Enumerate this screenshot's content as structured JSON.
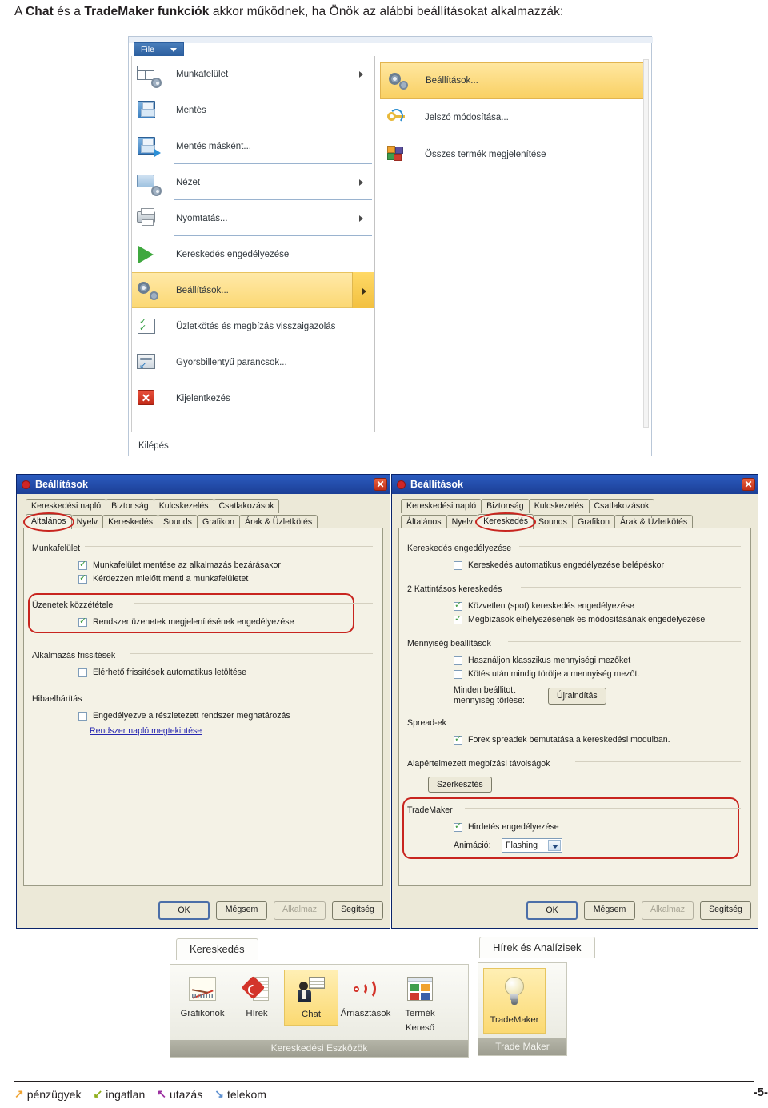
{
  "intro": {
    "before": "A ",
    "bold1": "Chat",
    "mid1": " és a ",
    "bold2": "TradeMaker funkciók",
    "after": " akkor működnek, ha Önök az alábbi beállításokat alkalmazzák:"
  },
  "file_menu": {
    "tab_label": "File",
    "items": [
      {
        "label": "Munkafelület",
        "icon": "workspace-icon",
        "submenu": true
      },
      {
        "label": "Mentés",
        "icon": "save-icon",
        "submenu": false
      },
      {
        "label": "Mentés másként...",
        "icon": "save-as-icon",
        "submenu": false
      },
      {
        "label": "Nézet",
        "icon": "view-icon",
        "submenu": true
      },
      {
        "label": "Nyomtatás...",
        "icon": "printer-icon",
        "submenu": true
      },
      {
        "label": "Kereskedés engedélyezése",
        "icon": "play-icon",
        "submenu": false
      },
      {
        "label": "Beállítások...",
        "icon": "gears-icon",
        "submenu": true,
        "highlighted": true
      },
      {
        "label": "Üzletkötés és megbízás visszaigazolás",
        "icon": "checklist-icon",
        "submenu": false
      },
      {
        "label": "Gyorsbillentyű parancsok...",
        "icon": "keyboard-icon",
        "submenu": false
      },
      {
        "label": "Kijelentkezés",
        "icon": "logout-x-icon",
        "submenu": false
      }
    ],
    "exit_label": "Kilépés",
    "submenu_items": [
      {
        "label": "Beállítások...",
        "icon": "gears-icon",
        "highlighted": true
      },
      {
        "label": "Jelszó módosítása...",
        "icon": "key-icon",
        "highlighted": false
      },
      {
        "label": "Összes termék megjelenítése",
        "icon": "products-icon",
        "highlighted": false
      }
    ]
  },
  "dialog_left": {
    "title": "Beállítások",
    "close_label": "✕",
    "tabs_row1": [
      "Kereskedési napló",
      "Biztonság",
      "Kulcskezelés",
      "Csatlakozások"
    ],
    "tabs_row2": [
      "Általános",
      "Nyelv",
      "Kereskedés",
      "Sounds",
      "Grafikon",
      "Árak & Üzletkötés"
    ],
    "selected_tab": "Általános",
    "groups": [
      {
        "label": "Munkafelület",
        "checkboxes": [
          {
            "label": "Munkafelület mentése az alkalmazás bezárásakor",
            "checked": true
          },
          {
            "label": "Kérdezzen mielőtt menti a munkafelületet",
            "checked": true
          }
        ]
      },
      {
        "label": "Üzenetek közzététele",
        "highlighted": true,
        "checkboxes": [
          {
            "label": "Rendszer üzenetek megjelenítésének engedélyezése",
            "checked": true
          }
        ]
      },
      {
        "label": "Alkalmazás frissitések",
        "checkboxes": [
          {
            "label": "Elérhető frissitések automatikus letöltése",
            "checked": false
          }
        ]
      },
      {
        "label": "Hibaelhárítás",
        "checkboxes": [
          {
            "label": "Engedélyezve a részletezett rendszer meghatározás",
            "checked": false
          }
        ],
        "link": "Rendszer napló megtekintése"
      }
    ],
    "buttons": [
      {
        "label": "OK",
        "state": "default"
      },
      {
        "label": "Mégsem",
        "state": "normal"
      },
      {
        "label": "Alkalmaz",
        "state": "disabled"
      },
      {
        "label": "Segítség",
        "state": "normal"
      }
    ]
  },
  "dialog_right": {
    "title": "Beállítások",
    "close_label": "✕",
    "tabs_row1": [
      "Kereskedési napló",
      "Biztonság",
      "Kulcskezelés",
      "Csatlakozások"
    ],
    "tabs_row2": [
      "Általános",
      "Nyelv",
      "Kereskedés",
      "Sounds",
      "Grafikon",
      "Árak & Üzletkötés"
    ],
    "selected_tab": "Kereskedés",
    "groups": [
      {
        "label": "Kereskedés engedélyezése",
        "checkboxes": [
          {
            "label": "Kereskedés automatikus engedélyezése belépéskor",
            "checked": false
          }
        ]
      },
      {
        "label": "2 Kattintásos kereskedés",
        "checkboxes": [
          {
            "label": "Közvetlen (spot) kereskedés engedélyezése",
            "checked": true
          },
          {
            "label": "Megbízások elhelyezésének és módosításának engedélyezése",
            "checked": true
          }
        ]
      },
      {
        "label": "Mennyiség beállítások",
        "checkboxes": [
          {
            "label": "Használjon klasszikus mennyiségi mezőket",
            "checked": false
          },
          {
            "label": "Kötés után mindig törölje a mennyiség mezőt.",
            "checked": false
          }
        ],
        "inline": {
          "label": "Minden beállitott mennyiség törlése:",
          "button": "Újraindítás"
        }
      },
      {
        "label": "Spread-ek",
        "checkboxes": [
          {
            "label": "Forex spreadek bemutatása a kereskedési modulban.",
            "checked": true
          }
        ]
      },
      {
        "label": "Alapértelmezett megbízási távolságok",
        "checkboxes": [],
        "button": "Szerkesztés"
      },
      {
        "label": "TradeMaker",
        "highlighted": true,
        "checkboxes": [
          {
            "label": "Hirdetés engedélyezése",
            "checked": true
          }
        ],
        "inline": {
          "label": "Animáció:",
          "combo_value": "Flashing"
        }
      }
    ],
    "buttons": [
      {
        "label": "OK",
        "state": "default"
      },
      {
        "label": "Mégsem",
        "state": "normal"
      },
      {
        "label": "Alkalmaz",
        "state": "disabled"
      },
      {
        "label": "Segítség",
        "state": "normal"
      }
    ]
  },
  "ribbon_left": {
    "tab_label": "Kereskedés",
    "group_label": "Kereskedési Eszközök",
    "items": [
      {
        "label": "Grafikonok",
        "icon": "chart-icon",
        "highlighted": false
      },
      {
        "label": "Hírek",
        "icon": "rss-news-icon",
        "highlighted": false
      },
      {
        "label": "Chat",
        "icon": "chat-person-icon",
        "highlighted": true
      },
      {
        "label": "Árriasztások",
        "icon": "price-alert-icon",
        "highlighted": false
      },
      {
        "label": "Termék Kereső",
        "icon": "product-finder-icon",
        "highlighted": false
      }
    ]
  },
  "ribbon_right": {
    "tab_label": "Hírek és Analízisek",
    "group_label": "Trade Maker",
    "items": [
      {
        "label": "TradeMaker",
        "icon": "lightbulb-icon",
        "highlighted": true
      }
    ]
  },
  "footer": {
    "links": [
      {
        "glyph": "↗",
        "label": "pénzügyek",
        "color": "#f0a22e"
      },
      {
        "glyph": "↙",
        "label": "ingatlan",
        "color": "#8fae1b"
      },
      {
        "glyph": "↖",
        "label": "utazás",
        "color": "#9b2fa0"
      },
      {
        "glyph": "↘",
        "label": "telekom",
        "color": "#5b8fd0"
      }
    ],
    "page": "-5-"
  },
  "colors": {
    "accent_highlight": "#fbd874",
    "annotation_red": "#c8251f",
    "titlebar_blue": "#1c3f96",
    "link_blue": "#2727b0"
  }
}
